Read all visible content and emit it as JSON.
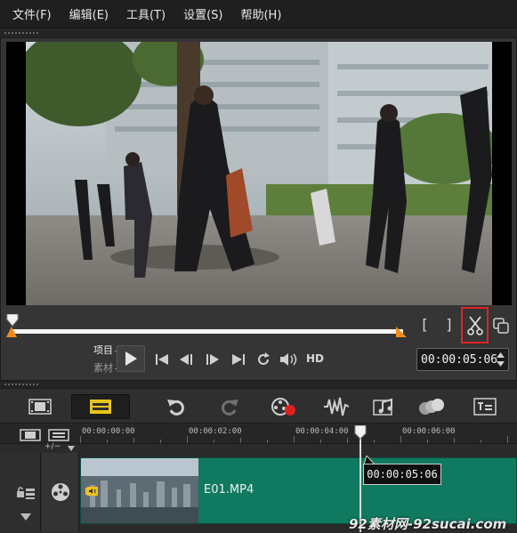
{
  "menu": {
    "file": "文件(F)",
    "edit": "编辑(E)",
    "tools": "工具(T)",
    "settings": "设置(S)",
    "help": "帮助(H)"
  },
  "player": {
    "mode_project": "项目",
    "mode_clip": "素材",
    "hd": "HD",
    "timecode": "00:00:05:06",
    "mark_in": "[",
    "mark_out": "]",
    "position_fraction": 0.0
  },
  "timeline": {
    "ruler_ticks": [
      "00:00:00:00",
      "00:00:02:00",
      "00:00:04:00",
      "00:00:06:00"
    ],
    "track_sub_label": "+/−",
    "clip_name": "E01.MP4",
    "playhead_timecode": "00:00:05:06"
  },
  "colors": {
    "accent_orange": "#f08c1a",
    "clip_green": "#0f7a60",
    "cut_highlight": "#e02424",
    "active_tool_yellow": "#e8c51a"
  },
  "watermark": "92素材网-92sucai.com"
}
